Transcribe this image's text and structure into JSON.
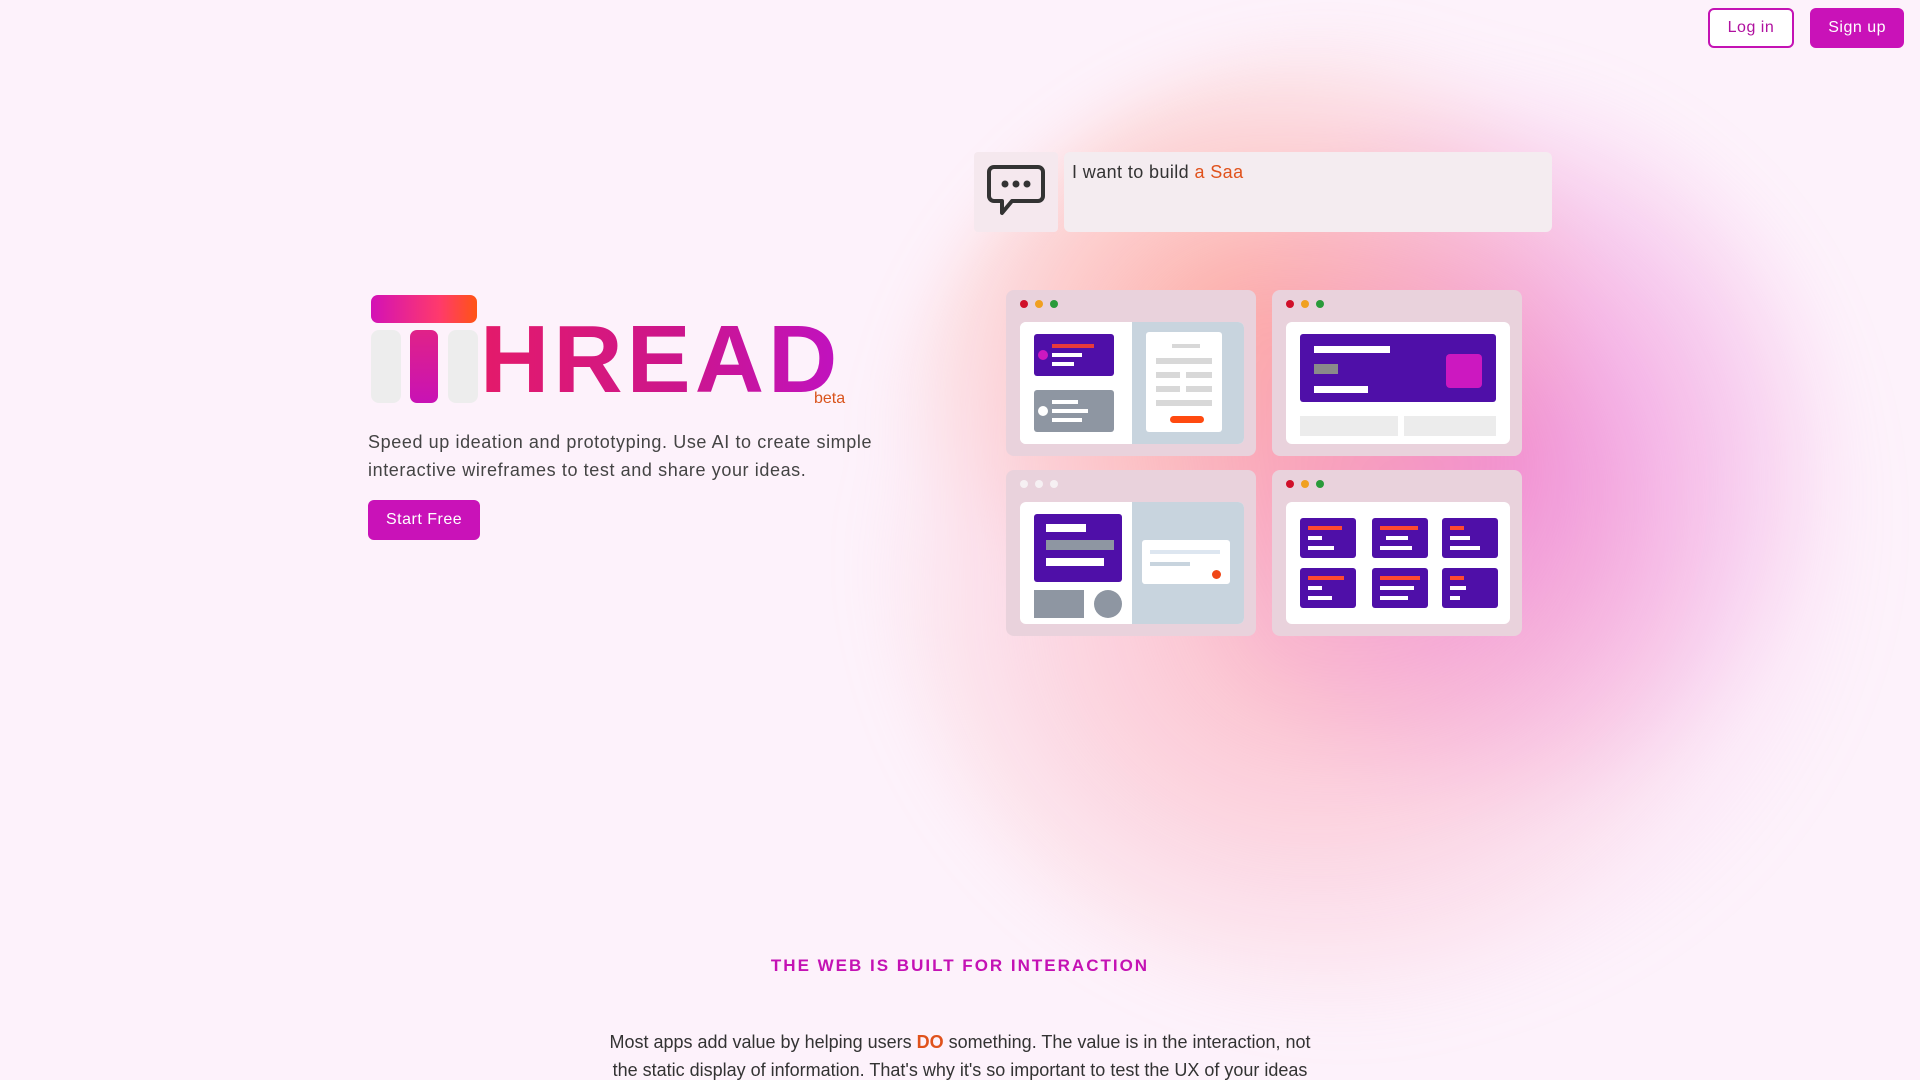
{
  "header": {
    "login_label": "Log in",
    "signup_label": "Sign up"
  },
  "hero": {
    "logo_word": "HREAD",
    "logo_badge": "beta",
    "tagline": "Speed up ideation and prototyping. Use AI to create simple interactive wireframes to test and share your ideas.",
    "cta_label": "Start Free"
  },
  "prompt": {
    "prefix": "I want to build ",
    "typed": "a Saa"
  },
  "section": {
    "title": "THE WEB IS BUILT FOR INTERACTION",
    "body_part1": "Most apps add value by helping users ",
    "body_emphasis": "DO",
    "body_part2": " something. The value is in the interaction, not the static display of information. That's why it's so important to test the UX of your ideas"
  },
  "colors": {
    "brand": "#c912b8",
    "accent_orange": "#e0521c",
    "mock_purple": "#4f0fa8",
    "background": "#fdf2fb"
  },
  "icons": {
    "chat": "speech-bubble-ellipsis-icon"
  }
}
